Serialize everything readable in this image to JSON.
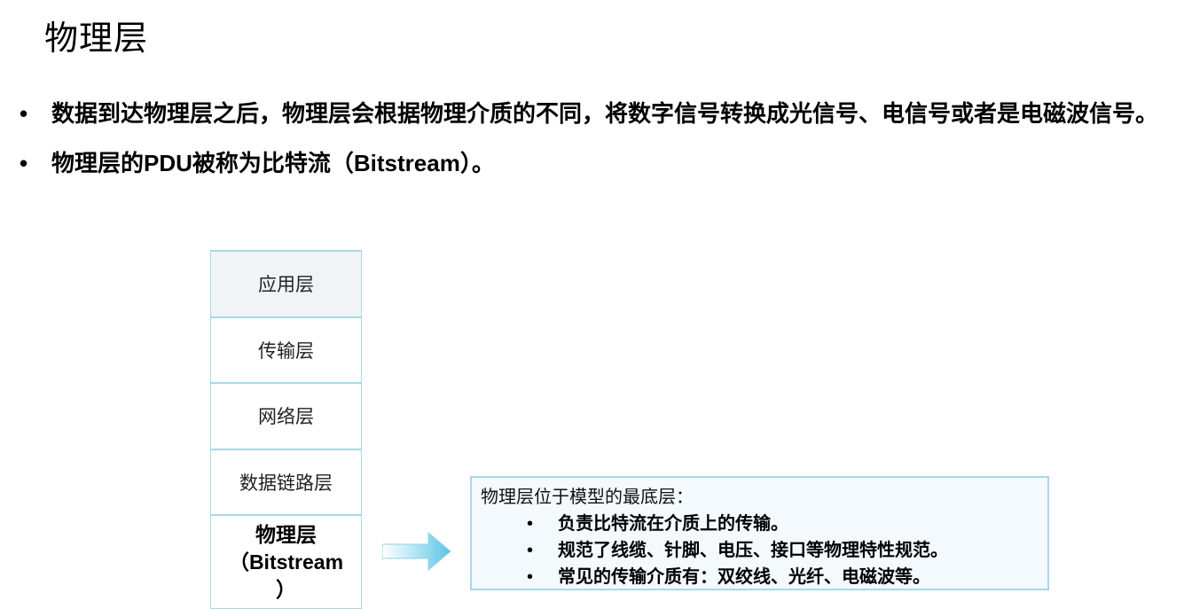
{
  "title": "物理层",
  "bullets": [
    {
      "text": "数据到达物理层之后，物理层会根据物理介质的不同，将数字信号转换成光信号、电信号或者是电磁波信号。"
    },
    {
      "text": "物理层的PDU被称为比特流（Bitstream）。"
    }
  ],
  "layers": [
    {
      "label": "应用层"
    },
    {
      "label": "传输层"
    },
    {
      "label": "网络层"
    },
    {
      "label": "数据链路层"
    },
    {
      "label_line1": "物理层",
      "label_line2": "（Bitstream",
      "label_line3": "）"
    }
  ],
  "note": {
    "heading": "物理层位于模型的最底层：",
    "items": [
      "负责比特流在介质上的传输。",
      "规范了线缆、针脚、电压、接口等物理特性规范。",
      "常见的传输介质有：双绞线、光纤、电磁波等。"
    ]
  },
  "colors": {
    "border": "#a8d8e6",
    "note_bg": "#f3f9fc",
    "arrow_fill": "#7fd0ec"
  },
  "icons": {
    "arrow": "right-arrow-icon"
  }
}
